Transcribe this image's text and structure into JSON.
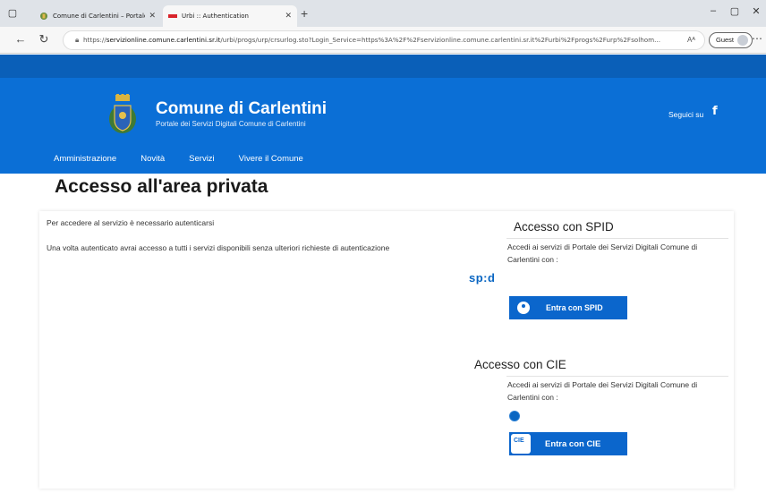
{
  "browser": {
    "tabs": [
      {
        "title": "Comune di Carlentini – Portale ser",
        "active": false
      },
      {
        "title": "Urbi :: Authentication",
        "active": true
      }
    ],
    "url_prefix": "https://",
    "url_domain": "servizionline.comune.carlentini.sr.it",
    "url_rest": "/urbi/progs/urp/crsurlog.sto?Login_Service=https%3A%2F%2Fservizionline.comune.carlentini.sr.it%2Furbi%2Fprogs%2Furp%2Fsolhom...",
    "profile_label": "Guest",
    "icons": {
      "back": "back-arrow-icon",
      "reload": "reload-icon",
      "lock": "lock-icon",
      "reader": "read-aloud-icon",
      "more": "more-icon"
    }
  },
  "site": {
    "title": "Comune di Carlentini",
    "subtitle": "Portale dei Servizi Digitali Comune di Carlentini",
    "follow_label": "Seguici su",
    "facebook_glyph": "f",
    "menu": [
      "Amministrazione",
      "Novità",
      "Servizi",
      "Vivere il Comune"
    ],
    "colors": {
      "header": "#0b6fd6",
      "top_strip": "#0a5fb8",
      "button": "#0b66cc"
    }
  },
  "main": {
    "heading": "Accesso all'area privata",
    "intro": "Per accedere al servizio è necessario autenticarsi",
    "info": "Una volta autenticato avrai accesso a tutti i servizi disponibili senza ulteriori richieste di autenticazione",
    "spid": {
      "title": "Accesso con SPID",
      "description": "Accedi ai servizi di Portale dei Servizi Digitali Comune di Carlentini con :",
      "logo_text": "sp:d",
      "button_label": "Entra con SPID"
    },
    "cie": {
      "title": "Accesso con CIE",
      "description": "Accedi ai servizi di Portale dei Servizi Digitali Comune di Carlentini con :",
      "button_label": "Entra con CIE",
      "button_icon_text": "CIE"
    }
  }
}
